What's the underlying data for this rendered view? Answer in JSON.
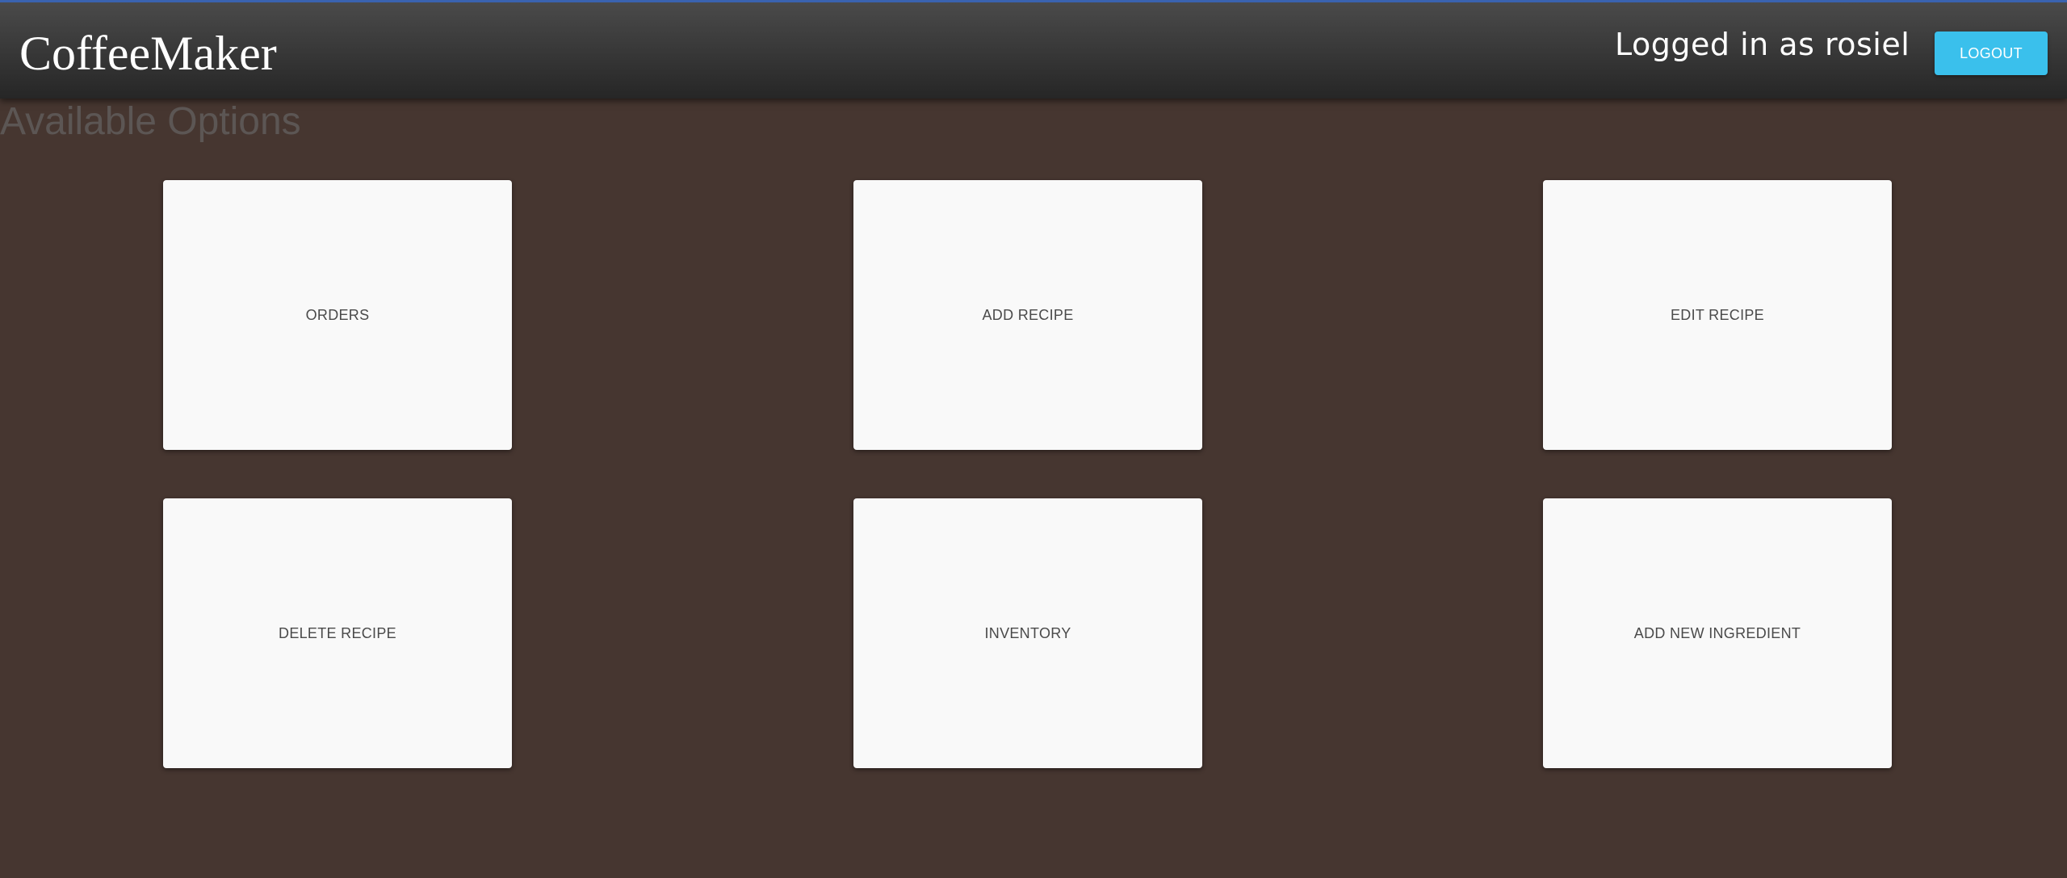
{
  "header": {
    "brand": "CoffeeMaker",
    "logged_in_text": "Logged in as rosiel",
    "logout_label": "LOGOUT"
  },
  "main": {
    "title": "Available Options",
    "options": [
      {
        "label": "ORDERS"
      },
      {
        "label": "ADD RECIPE"
      },
      {
        "label": "EDIT RECIPE"
      },
      {
        "label": "DELETE RECIPE"
      },
      {
        "label": "INVENTORY"
      },
      {
        "label": "ADD NEW INGREDIENT"
      }
    ]
  },
  "colors": {
    "background": "#463630",
    "accent": "#3ac0ec",
    "card": "#f9f9f9"
  }
}
